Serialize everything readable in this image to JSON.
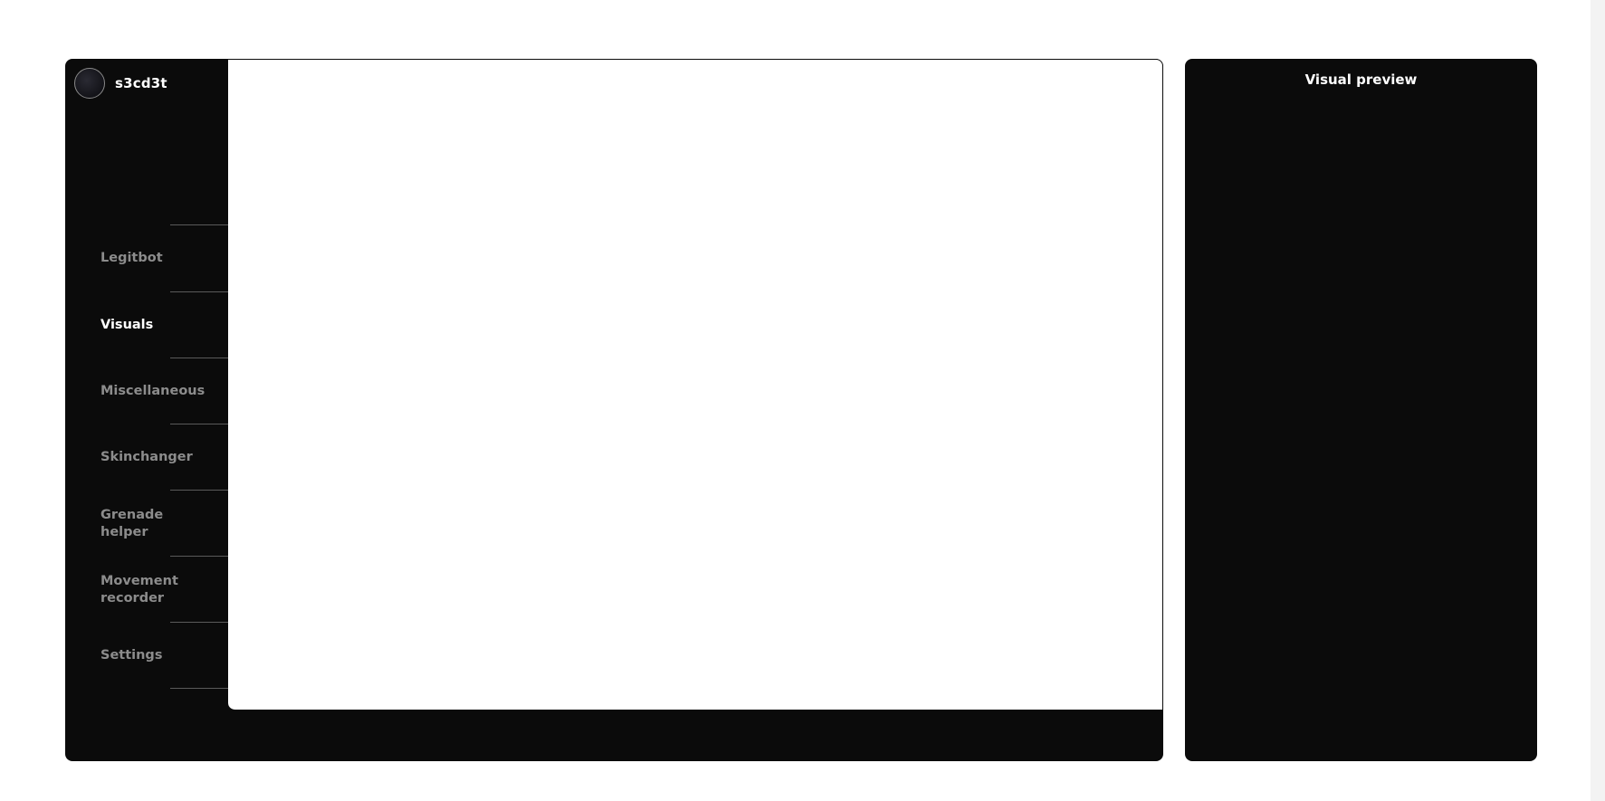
{
  "user": {
    "name": "s3cd3t"
  },
  "nav": {
    "items": [
      {
        "label": "Legitbot",
        "active": false
      },
      {
        "label": "Visuals",
        "active": true
      },
      {
        "label": "Miscellaneous",
        "active": false
      },
      {
        "label": "Skinchanger",
        "active": false
      },
      {
        "label": "Grenade helper",
        "active": false
      },
      {
        "label": "Movement recorder",
        "active": false
      },
      {
        "label": "Settings",
        "active": false
      }
    ]
  },
  "preview": {
    "title": "Visual preview"
  },
  "colors": {
    "panel_bg": "#0b0b0b",
    "active_text": "#ffffff",
    "inactive_text": "#8c8c8c",
    "divider": "#5a5a5a"
  }
}
